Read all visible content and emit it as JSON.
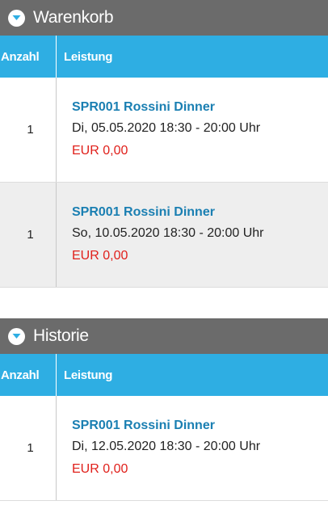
{
  "cart": {
    "title": "Warenkorb",
    "columns": {
      "qty": "Anzahl",
      "service": "Leistung"
    },
    "rows": [
      {
        "qty": "1",
        "title": "SPR001 Rossini Dinner",
        "date": "Di, 05.05.2020 18:30 - 20:00 Uhr",
        "price": "EUR 0,00"
      },
      {
        "qty": "1",
        "title": "SPR001 Rossini Dinner",
        "date": "So, 10.05.2020 18:30 - 20:00 Uhr",
        "price": "EUR 0,00"
      }
    ]
  },
  "history": {
    "title": "Historie",
    "columns": {
      "qty": "Anzahl",
      "service": "Leistung"
    },
    "rows": [
      {
        "qty": "1",
        "title": "SPR001 Rossini Dinner",
        "date": "Di, 12.05.2020 18:30 - 20:00 Uhr",
        "price": "EUR 0,00"
      }
    ]
  },
  "icons": {
    "toggle": "chevron-down-icon"
  },
  "colors": {
    "header_bg": "#6b6b6b",
    "column_header_bg": "#2eaee3",
    "title_link": "#1a7fb2",
    "price": "#e0201b",
    "row_alt_bg": "#eeeeee"
  }
}
